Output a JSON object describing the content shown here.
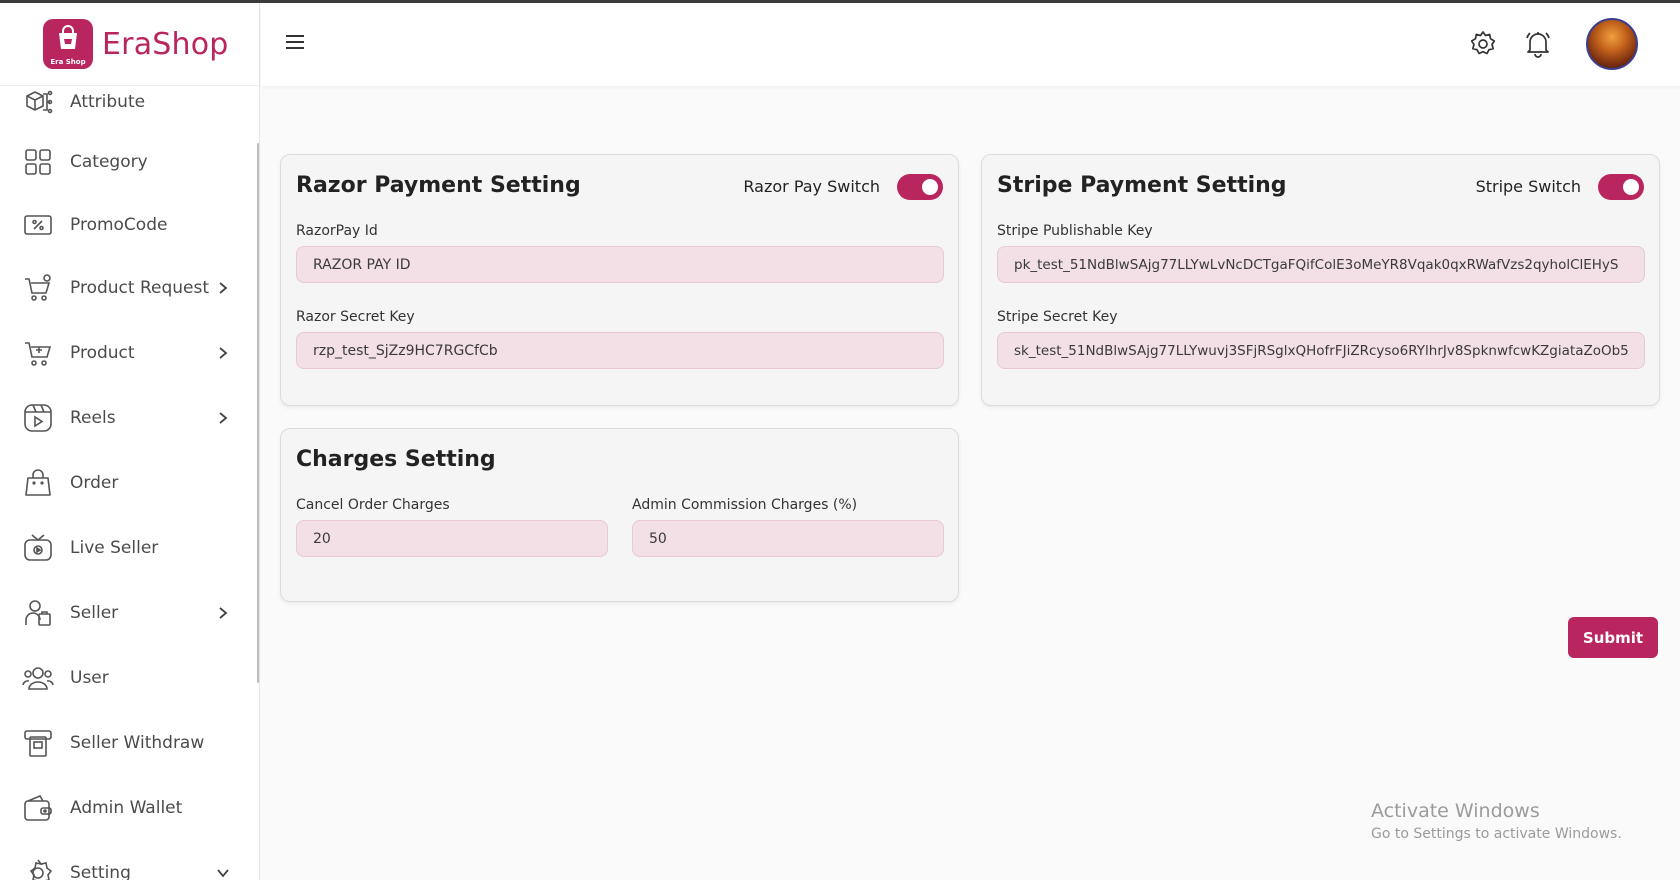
{
  "app": {
    "name": "EraShop",
    "logo_badge_text": "Era Shop",
    "brand_color": "#b9265f"
  },
  "sidebar": {
    "items": [
      {
        "label": "Attribute",
        "icon": "attribute-icon",
        "has_chevron": false
      },
      {
        "label": "Category",
        "icon": "category-icon",
        "has_chevron": false
      },
      {
        "label": "PromoCode",
        "icon": "promocode-icon",
        "has_chevron": false
      },
      {
        "label": "Product Request",
        "icon": "cart-request-icon",
        "has_chevron": true
      },
      {
        "label": "Product",
        "icon": "cart-add-icon",
        "has_chevron": true
      },
      {
        "label": "Reels",
        "icon": "reels-icon",
        "has_chevron": true
      },
      {
        "label": "Order",
        "icon": "bag-icon",
        "has_chevron": false
      },
      {
        "label": "Live Seller",
        "icon": "live-tv-icon",
        "has_chevron": false
      },
      {
        "label": "Seller",
        "icon": "seller-icon",
        "has_chevron": true
      },
      {
        "label": "User",
        "icon": "users-icon",
        "has_chevron": false
      },
      {
        "label": "Seller Withdraw",
        "icon": "withdraw-icon",
        "has_chevron": false
      },
      {
        "label": "Admin Wallet",
        "icon": "wallet-icon",
        "has_chevron": false
      },
      {
        "label": "Setting",
        "icon": "gear-icon",
        "has_chevron": true
      }
    ]
  },
  "header": {
    "menu_icon": "hamburger-icon",
    "settings_icon": "gear-icon",
    "notification_icon": "bell-icon",
    "avatar": "user-avatar"
  },
  "razor": {
    "title": "Razor Payment Setting",
    "switch_label": "Razor Pay Switch",
    "switch_on": true,
    "id_label": "RazorPay Id",
    "id_value": "RAZOR PAY ID",
    "secret_label": "Razor Secret Key",
    "secret_value": "rzp_test_SjZz9HC7RGCfCb"
  },
  "stripe": {
    "title": "Stripe Payment Setting",
    "switch_label": "Stripe Switch",
    "switch_on": true,
    "publishable_label": "Stripe Publishable Key",
    "publishable_value": "pk_test_51NdBlwSAjg77LLYwLvNcDCTgaFQifColE3oMeYR8Vqak0qxRWafVzs2qyholClEHyS",
    "secret_label": "Stripe Secret Key",
    "secret_value": "sk_test_51NdBlwSAjg77LLYwuvj3SFjRSglxQHofrFJiZRcyso6RYlhrJv8SpknwfcwKZgiataZoOb5"
  },
  "charges": {
    "title": "Charges Setting",
    "cancel_label": "Cancel Order Charges",
    "cancel_value": "20",
    "commission_label": "Admin Commission Charges (%)",
    "commission_value": "50"
  },
  "actions": {
    "submit_label": "Submit"
  },
  "watermark": {
    "line1": "Activate Windows",
    "line2": "Go to Settings to activate Windows."
  }
}
